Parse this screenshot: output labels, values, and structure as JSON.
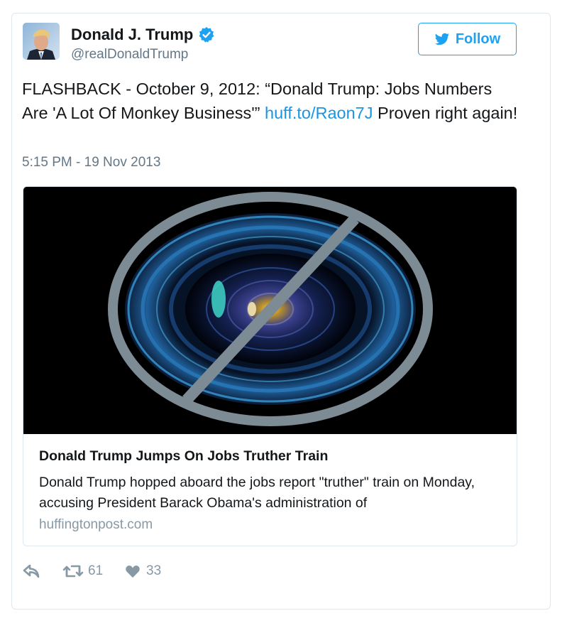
{
  "user": {
    "name": "Donald J. Trump",
    "handle": "@realDonaldTrump",
    "verified_icon": "verified-badge-icon"
  },
  "follow": {
    "label": "Follow",
    "icon": "twitter-bird-icon",
    "color": "#1da1f2"
  },
  "tweet": {
    "text_before": "FLASHBACK - October 9, 2012: “Donald Trump: Jobs Numbers Are 'A Lot Of Monkey Business'” ",
    "link": "huff.to/Raon7J",
    "text_after": " Proven right again!",
    "timestamp": "5:15 PM - 19 Nov 2013",
    "link_color": "#1b95e0"
  },
  "card": {
    "image_icon": "camera-lens-with-prohibition-sign",
    "title": "Donald Trump Jumps On Jobs Truther Train",
    "description": "Donald Trump hopped aboard the jobs report \"truther\" train on Monday, accusing President Barack Obama's administration of",
    "domain": "huffingtonpost.com"
  },
  "actions": {
    "reply_icon": "reply-icon",
    "retweet_icon": "retweet-icon",
    "retweet_count": "61",
    "like_icon": "heart-icon",
    "like_count": "33"
  }
}
